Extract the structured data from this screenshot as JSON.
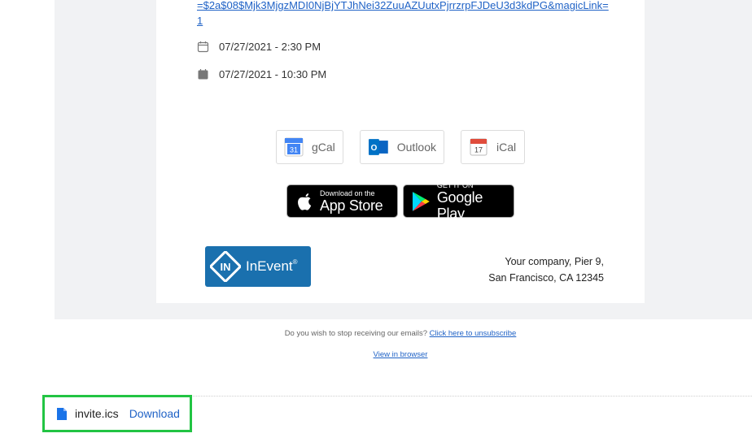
{
  "email": {
    "magic_link": "=$2a$08$Mjk3MjgzMDI0NjBjYTJhNei32ZuuAZUutxPjrrzrpFJDeU3d3kdPG&magicLink=1",
    "start_datetime": "07/27/2021 - 2:30 PM",
    "end_datetime": "07/27/2021 - 10:30 PM",
    "calendar_buttons": {
      "gcal": {
        "label": "gCal",
        "icon": "google-calendar-icon",
        "icon_text": "31"
      },
      "outlook": {
        "label": "Outlook",
        "icon": "outlook-icon",
        "icon_text": "O"
      },
      "ical": {
        "label": "iCal",
        "icon": "ical-icon",
        "icon_text": "17"
      }
    },
    "app_store": {
      "small": "Download on the",
      "big": "App Store",
      "icon": "apple-icon"
    },
    "google_play": {
      "small": "GET IT ON",
      "big": "Google Play",
      "icon": "google-play-icon"
    },
    "logo": {
      "brand": "InEvent",
      "reg": "®",
      "mark": "IN",
      "color": "#1a70ae"
    },
    "address": {
      "line1": "Your company, Pier 9,",
      "line2": "San Francisco, CA 12345"
    },
    "footer": {
      "unsubscribe_prompt": "Do you wish to stop receiving our emails?",
      "unsubscribe_link": "Click here to unsubscribe",
      "view_in_browser": "View in browser"
    }
  },
  "attachment": {
    "filename": "invite.ics",
    "download_label": "Download",
    "icon": "file-icon",
    "highlight_color": "#22c443"
  },
  "colors": {
    "link": "#1f62c6",
    "background": "#f1f2f4"
  }
}
